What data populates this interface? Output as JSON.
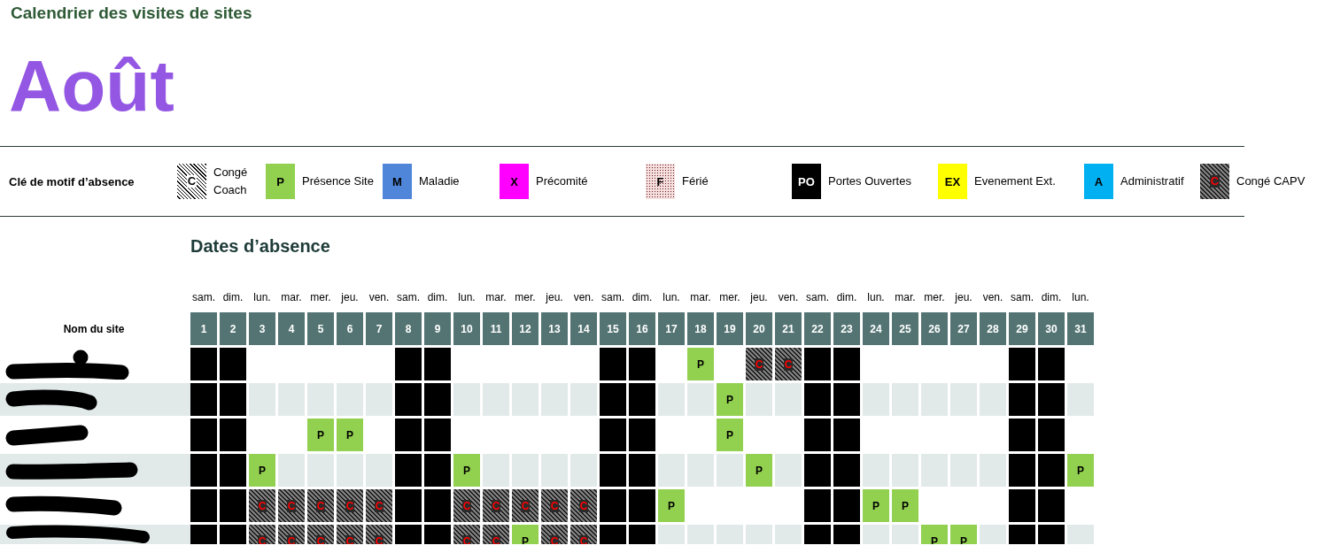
{
  "title": "Calendrier des visites de sites",
  "month": "Août",
  "legend": {
    "label": "Clé de motif d’absence",
    "items": [
      {
        "code": "C",
        "label": "Congé Coach",
        "kind": "hatch",
        "color": "#ffffff"
      },
      {
        "code": "P",
        "label": "Présence Site",
        "kind": "solid",
        "color": "#92d050"
      },
      {
        "code": "M",
        "label": "Maladie",
        "kind": "solid",
        "color": "#4f86d9"
      },
      {
        "code": "X",
        "label": "Précomité",
        "kind": "solid",
        "color": "#ff00ff"
      },
      {
        "code": "F",
        "label": "Férié",
        "kind": "dots",
        "color": "#f4dede"
      },
      {
        "code": "PO",
        "label": "Portes Ouvertes",
        "kind": "solid",
        "color": "#000000"
      },
      {
        "code": "EX",
        "label": "Evenement Ext.",
        "kind": "solid",
        "color": "#ffff00"
      },
      {
        "code": "A",
        "label": "Administratif",
        "kind": "solid",
        "color": "#00b0f0"
      },
      {
        "code": "C",
        "label": "Congé CAPV",
        "kind": "dark_hatch",
        "color": "#808080"
      }
    ]
  },
  "section_title": "Dates d’absence",
  "site_column": "Nom du site",
  "days": [
    {
      "weekday": "sam.",
      "day": "1"
    },
    {
      "weekday": "dim.",
      "day": "2"
    },
    {
      "weekday": "lun.",
      "day": "3"
    },
    {
      "weekday": "mar.",
      "day": "4"
    },
    {
      "weekday": "mer.",
      "day": "5"
    },
    {
      "weekday": "jeu.",
      "day": "6"
    },
    {
      "weekday": "ven.",
      "day": "7"
    },
    {
      "weekday": "sam.",
      "day": "8"
    },
    {
      "weekday": "dim.",
      "day": "9"
    },
    {
      "weekday": "lun.",
      "day": "10"
    },
    {
      "weekday": "mar.",
      "day": "11"
    },
    {
      "weekday": "mer.",
      "day": "12"
    },
    {
      "weekday": "jeu.",
      "day": "13"
    },
    {
      "weekday": "ven.",
      "day": "14"
    },
    {
      "weekday": "sam.",
      "day": "15"
    },
    {
      "weekday": "dim.",
      "day": "16"
    },
    {
      "weekday": "lun.",
      "day": "17"
    },
    {
      "weekday": "mar.",
      "day": "18"
    },
    {
      "weekday": "mer.",
      "day": "19"
    },
    {
      "weekday": "jeu.",
      "day": "20"
    },
    {
      "weekday": "ven.",
      "day": "21"
    },
    {
      "weekday": "sam.",
      "day": "22"
    },
    {
      "weekday": "dim.",
      "day": "23"
    },
    {
      "weekday": "lun.",
      "day": "24"
    },
    {
      "weekday": "mar.",
      "day": "25"
    },
    {
      "weekday": "mer.",
      "day": "26"
    },
    {
      "weekday": "jeu.",
      "day": "27"
    },
    {
      "weekday": "ven.",
      "day": "28"
    },
    {
      "weekday": "sam.",
      "day": "29"
    },
    {
      "weekday": "dim.",
      "day": "30"
    },
    {
      "weekday": "lun.",
      "day": "31"
    }
  ],
  "rows": [
    {
      "cells": [
        {
          "kind": "weekend"
        },
        {
          "kind": "weekend"
        },
        {
          "kind": "empty"
        },
        {
          "kind": "empty"
        },
        {
          "kind": "empty"
        },
        {
          "kind": "empty"
        },
        {
          "kind": "empty"
        },
        {
          "kind": "weekend"
        },
        {
          "kind": "weekend"
        },
        {
          "kind": "empty"
        },
        {
          "kind": "empty"
        },
        {
          "kind": "empty"
        },
        {
          "kind": "empty"
        },
        {
          "kind": "empty"
        },
        {
          "kind": "weekend"
        },
        {
          "kind": "weekend"
        },
        {
          "kind": "empty"
        },
        {
          "kind": "presence",
          "code": "P"
        },
        {
          "kind": "empty"
        },
        {
          "kind": "conge_capv",
          "code": "C"
        },
        {
          "kind": "conge_capv",
          "code": "C"
        },
        {
          "kind": "weekend"
        },
        {
          "kind": "weekend"
        },
        {
          "kind": "empty"
        },
        {
          "kind": "empty"
        },
        {
          "kind": "empty"
        },
        {
          "kind": "empty"
        },
        {
          "kind": "empty"
        },
        {
          "kind": "weekend"
        },
        {
          "kind": "weekend"
        },
        {
          "kind": "empty"
        }
      ]
    },
    {
      "cells": [
        {
          "kind": "weekend"
        },
        {
          "kind": "weekend"
        },
        {
          "kind": "empty"
        },
        {
          "kind": "empty"
        },
        {
          "kind": "empty"
        },
        {
          "kind": "empty"
        },
        {
          "kind": "empty"
        },
        {
          "kind": "weekend"
        },
        {
          "kind": "weekend"
        },
        {
          "kind": "empty"
        },
        {
          "kind": "empty"
        },
        {
          "kind": "empty"
        },
        {
          "kind": "empty"
        },
        {
          "kind": "empty"
        },
        {
          "kind": "weekend"
        },
        {
          "kind": "weekend"
        },
        {
          "kind": "empty"
        },
        {
          "kind": "empty"
        },
        {
          "kind": "presence",
          "code": "P"
        },
        {
          "kind": "empty"
        },
        {
          "kind": "empty"
        },
        {
          "kind": "weekend"
        },
        {
          "kind": "weekend"
        },
        {
          "kind": "empty"
        },
        {
          "kind": "empty"
        },
        {
          "kind": "empty"
        },
        {
          "kind": "empty"
        },
        {
          "kind": "empty"
        },
        {
          "kind": "weekend"
        },
        {
          "kind": "weekend"
        },
        {
          "kind": "empty"
        }
      ]
    },
    {
      "cells": [
        {
          "kind": "weekend"
        },
        {
          "kind": "weekend"
        },
        {
          "kind": "empty"
        },
        {
          "kind": "empty"
        },
        {
          "kind": "presence",
          "code": "P"
        },
        {
          "kind": "presence",
          "code": "P"
        },
        {
          "kind": "empty"
        },
        {
          "kind": "weekend"
        },
        {
          "kind": "weekend"
        },
        {
          "kind": "empty"
        },
        {
          "kind": "empty"
        },
        {
          "kind": "empty"
        },
        {
          "kind": "empty"
        },
        {
          "kind": "empty"
        },
        {
          "kind": "weekend"
        },
        {
          "kind": "weekend"
        },
        {
          "kind": "empty"
        },
        {
          "kind": "empty"
        },
        {
          "kind": "presence",
          "code": "P"
        },
        {
          "kind": "empty"
        },
        {
          "kind": "empty"
        },
        {
          "kind": "weekend"
        },
        {
          "kind": "weekend"
        },
        {
          "kind": "empty"
        },
        {
          "kind": "empty"
        },
        {
          "kind": "empty"
        },
        {
          "kind": "empty"
        },
        {
          "kind": "empty"
        },
        {
          "kind": "weekend"
        },
        {
          "kind": "weekend"
        },
        {
          "kind": "empty"
        }
      ]
    },
    {
      "cells": [
        {
          "kind": "weekend"
        },
        {
          "kind": "weekend"
        },
        {
          "kind": "presence",
          "code": "P"
        },
        {
          "kind": "empty"
        },
        {
          "kind": "empty"
        },
        {
          "kind": "empty"
        },
        {
          "kind": "empty"
        },
        {
          "kind": "weekend"
        },
        {
          "kind": "weekend"
        },
        {
          "kind": "presence",
          "code": "P"
        },
        {
          "kind": "empty"
        },
        {
          "kind": "empty"
        },
        {
          "kind": "empty"
        },
        {
          "kind": "empty"
        },
        {
          "kind": "weekend"
        },
        {
          "kind": "weekend"
        },
        {
          "kind": "empty"
        },
        {
          "kind": "empty"
        },
        {
          "kind": "empty"
        },
        {
          "kind": "presence",
          "code": "P"
        },
        {
          "kind": "empty"
        },
        {
          "kind": "weekend"
        },
        {
          "kind": "weekend"
        },
        {
          "kind": "empty"
        },
        {
          "kind": "empty"
        },
        {
          "kind": "empty"
        },
        {
          "kind": "empty"
        },
        {
          "kind": "empty"
        },
        {
          "kind": "weekend"
        },
        {
          "kind": "weekend"
        },
        {
          "kind": "presence",
          "code": "P"
        }
      ]
    },
    {
      "cells": [
        {
          "kind": "weekend"
        },
        {
          "kind": "weekend"
        },
        {
          "kind": "conge_capv",
          "code": "C"
        },
        {
          "kind": "conge_capv",
          "code": "C"
        },
        {
          "kind": "conge_capv",
          "code": "C"
        },
        {
          "kind": "conge_capv",
          "code": "C"
        },
        {
          "kind": "conge_capv",
          "code": "C"
        },
        {
          "kind": "weekend"
        },
        {
          "kind": "weekend"
        },
        {
          "kind": "conge_capv",
          "code": "C"
        },
        {
          "kind": "conge_capv",
          "code": "C"
        },
        {
          "kind": "conge_capv",
          "code": "C"
        },
        {
          "kind": "conge_capv",
          "code": "C"
        },
        {
          "kind": "conge_capv",
          "code": "C"
        },
        {
          "kind": "weekend"
        },
        {
          "kind": "weekend"
        },
        {
          "kind": "presence",
          "code": "P"
        },
        {
          "kind": "empty"
        },
        {
          "kind": "empty"
        },
        {
          "kind": "empty"
        },
        {
          "kind": "empty"
        },
        {
          "kind": "weekend"
        },
        {
          "kind": "weekend"
        },
        {
          "kind": "presence",
          "code": "P"
        },
        {
          "kind": "presence",
          "code": "P"
        },
        {
          "kind": "empty"
        },
        {
          "kind": "empty"
        },
        {
          "kind": "empty"
        },
        {
          "kind": "weekend"
        },
        {
          "kind": "weekend"
        },
        {
          "kind": "empty"
        }
      ]
    },
    {
      "cells": [
        {
          "kind": "weekend"
        },
        {
          "kind": "weekend"
        },
        {
          "kind": "conge_capv",
          "code": "C"
        },
        {
          "kind": "conge_capv",
          "code": "C"
        },
        {
          "kind": "conge_capv",
          "code": "C"
        },
        {
          "kind": "conge_capv",
          "code": "C"
        },
        {
          "kind": "conge_capv",
          "code": "C"
        },
        {
          "kind": "weekend"
        },
        {
          "kind": "weekend"
        },
        {
          "kind": "conge_capv",
          "code": "C"
        },
        {
          "kind": "conge_capv",
          "code": "C"
        },
        {
          "kind": "presence",
          "code": "P"
        },
        {
          "kind": "conge_capv",
          "code": "C"
        },
        {
          "kind": "conge_capv",
          "code": "C"
        },
        {
          "kind": "weekend"
        },
        {
          "kind": "weekend"
        },
        {
          "kind": "empty"
        },
        {
          "kind": "empty"
        },
        {
          "kind": "empty"
        },
        {
          "kind": "empty"
        },
        {
          "kind": "empty"
        },
        {
          "kind": "weekend"
        },
        {
          "kind": "weekend"
        },
        {
          "kind": "empty"
        },
        {
          "kind": "empty"
        },
        {
          "kind": "presence",
          "code": "P"
        },
        {
          "kind": "presence",
          "code": "P"
        },
        {
          "kind": "empty"
        },
        {
          "kind": "weekend"
        },
        {
          "kind": "weekend"
        },
        {
          "kind": "empty"
        }
      ]
    }
  ]
}
